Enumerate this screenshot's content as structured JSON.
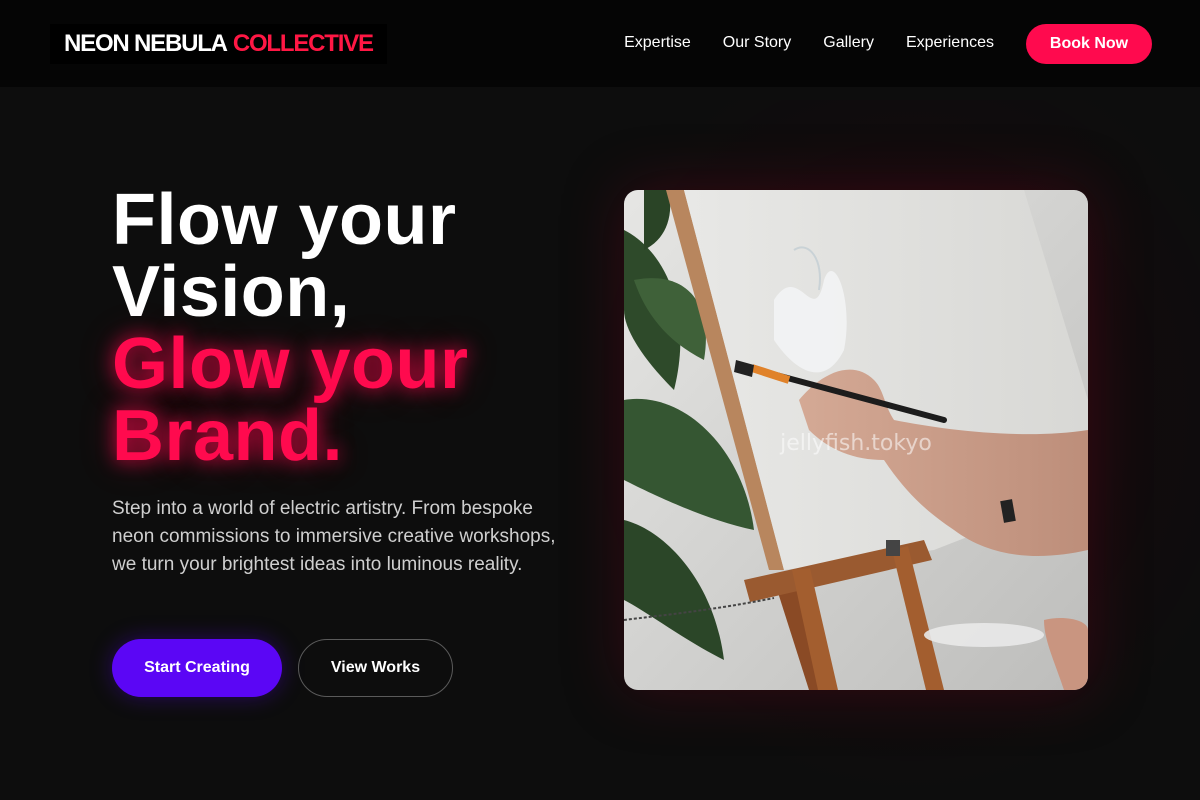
{
  "header": {
    "logo_part1": "NEON NEBULA",
    "logo_part2": "COLLECTIVE",
    "nav": [
      "Expertise",
      "Our Story",
      "Gallery",
      "Experiences"
    ],
    "cta": "Book Now"
  },
  "hero": {
    "headline_line1": "Flow your",
    "headline_line2": "Vision,",
    "headline_line3": "Glow your",
    "headline_line4": "Brand.",
    "description": "Step into a world of electric artistry. From bespoke neon commissions to immersive creative workshops, we turn your brightest ideas into luminous reality.",
    "primary_button": "Start Creating",
    "secondary_button": "View Works",
    "image_watermark": "jellyfish.tokyo"
  },
  "colors": {
    "accent_red": "#ff0a4e",
    "accent_purple": "#5b06f5",
    "background": "#0d0d0d"
  }
}
